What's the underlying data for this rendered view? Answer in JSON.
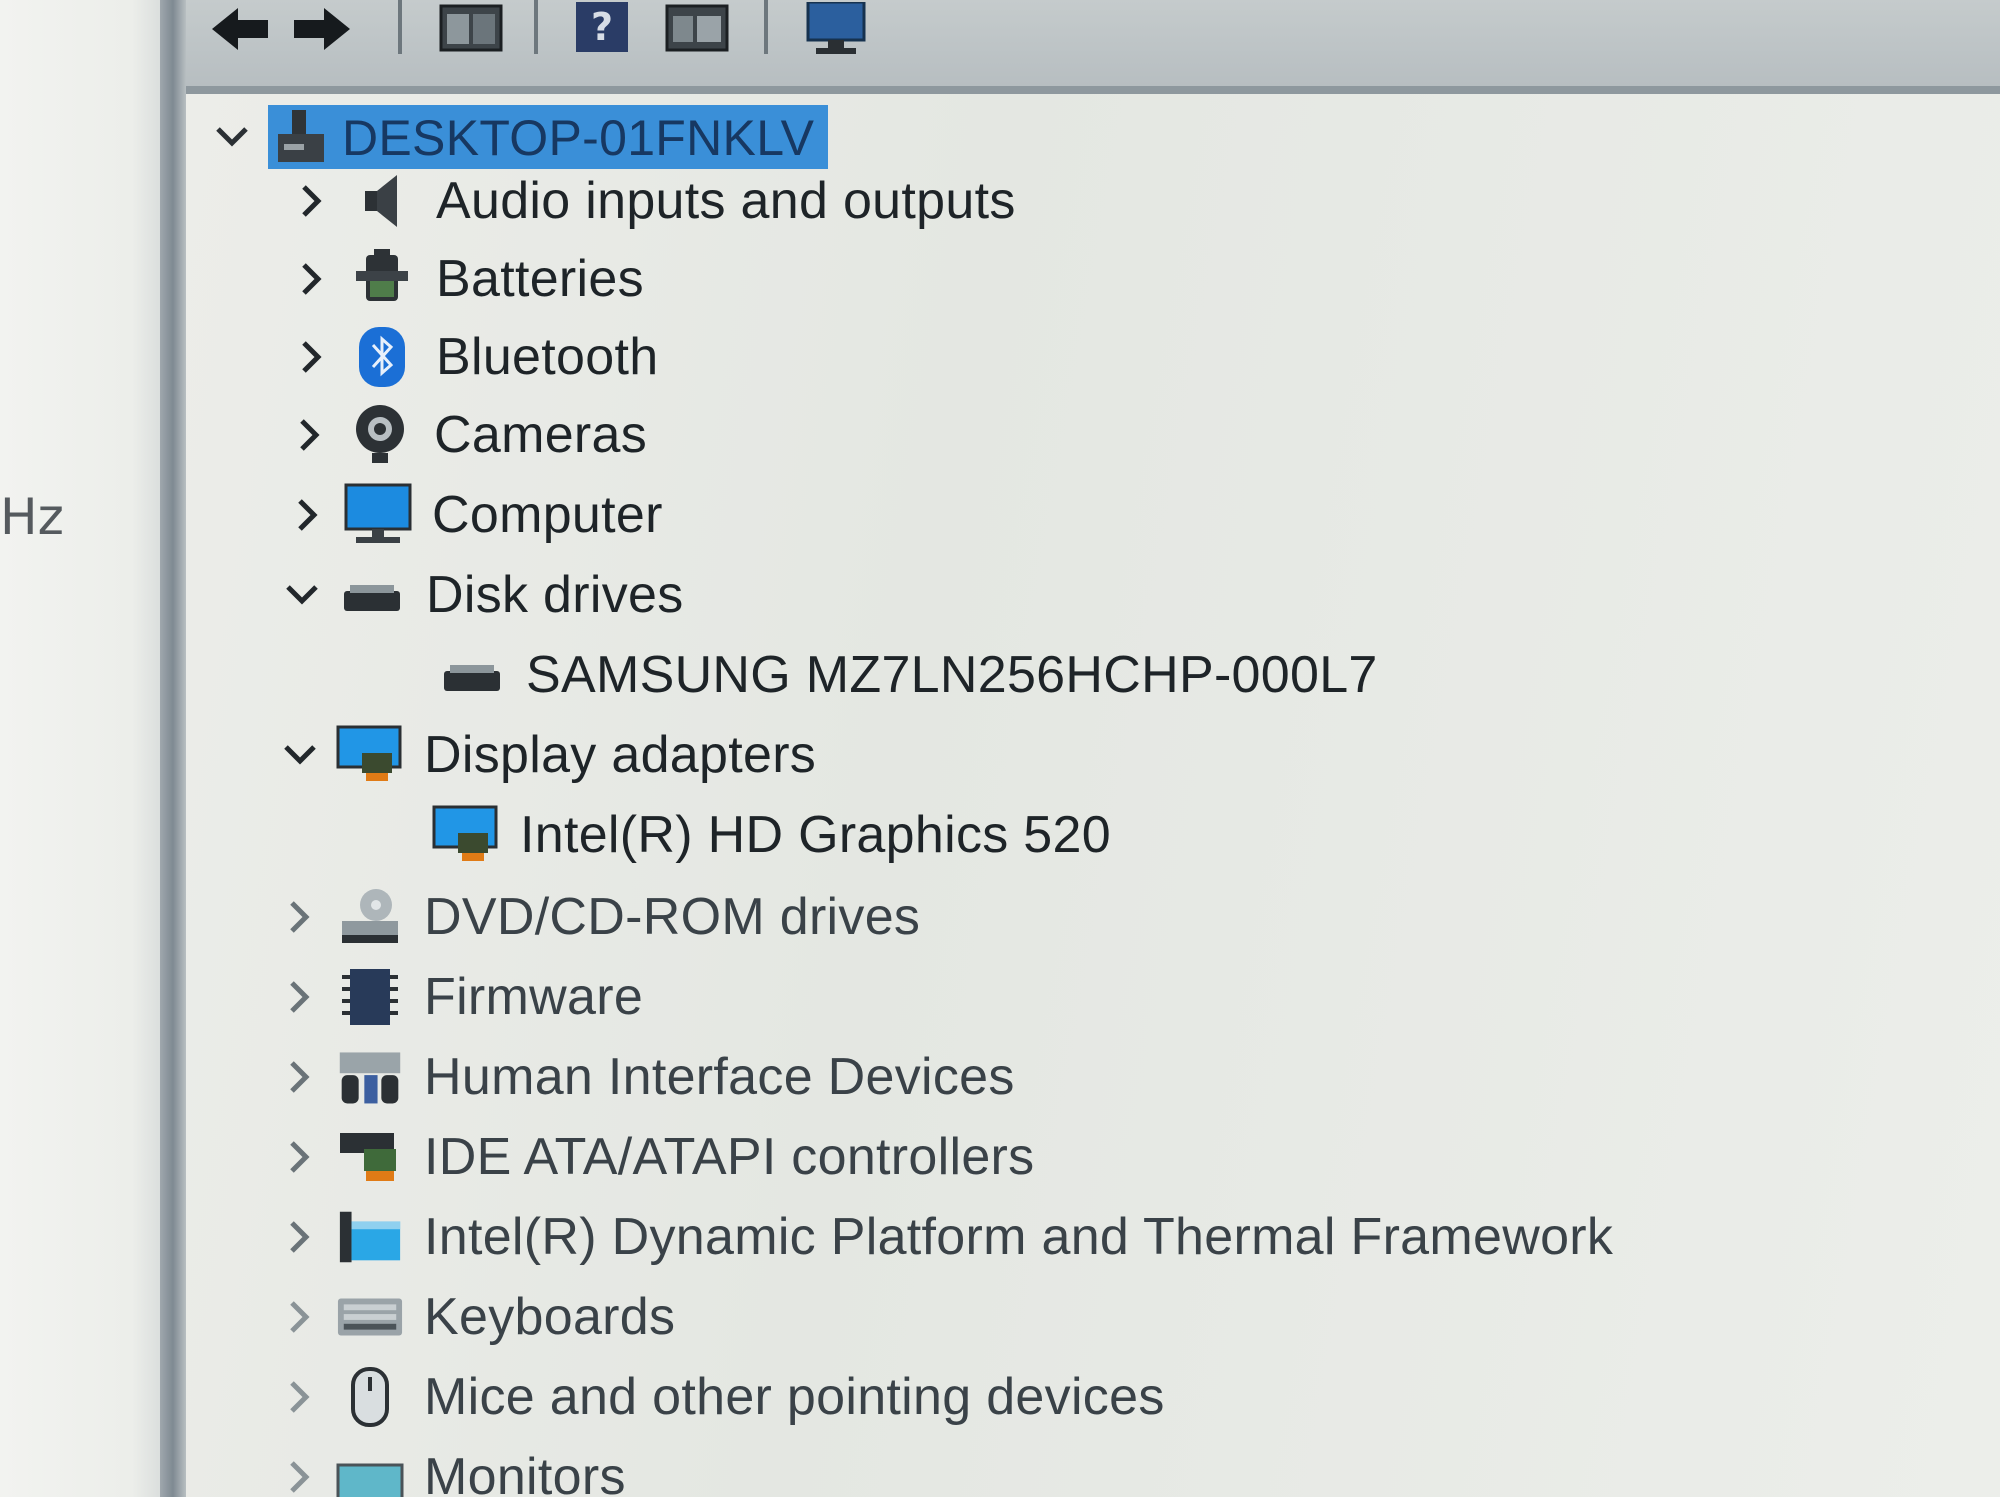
{
  "background_fragment": "Hz",
  "tree": {
    "root": "DESKTOP-01FNKLV",
    "categories": [
      {
        "label": "Audio inputs and outputs",
        "icon": "speaker-icon",
        "expanded": false
      },
      {
        "label": "Batteries",
        "icon": "battery-icon",
        "expanded": false
      },
      {
        "label": "Bluetooth",
        "icon": "bluetooth-icon",
        "expanded": false
      },
      {
        "label": "Cameras",
        "icon": "camera-icon",
        "expanded": false
      },
      {
        "label": "Computer",
        "icon": "monitor-icon",
        "expanded": false
      },
      {
        "label": "Disk drives",
        "icon": "disk-drive-icon",
        "expanded": true,
        "children": [
          "SAMSUNG MZ7LN256HCHP-000L7"
        ]
      },
      {
        "label": "Display adapters",
        "icon": "display-adapter-icon",
        "expanded": true,
        "children": [
          "Intel(R) HD Graphics 520"
        ]
      },
      {
        "label": "DVD/CD-ROM drives",
        "icon": "dvd-drive-icon",
        "expanded": false
      },
      {
        "label": "Firmware",
        "icon": "chip-icon",
        "expanded": false
      },
      {
        "label": "Human Interface Devices",
        "icon": "hid-icon",
        "expanded": false
      },
      {
        "label": "IDE ATA/ATAPI controllers",
        "icon": "ide-controller-icon",
        "expanded": false
      },
      {
        "label": "Intel(R) Dynamic Platform and Thermal Framework",
        "icon": "folder-icon",
        "expanded": false
      },
      {
        "label": "Keyboards",
        "icon": "keyboard-icon",
        "expanded": false
      },
      {
        "label": "Mice and other pointing devices",
        "icon": "mouse-icon",
        "expanded": false
      },
      {
        "label": "Monitors",
        "icon": "monitor-icon",
        "expanded": false
      }
    ]
  },
  "colors": {
    "selection": "#3a8fd8",
    "text": "#1e2428",
    "background": "#e7e9e4"
  }
}
